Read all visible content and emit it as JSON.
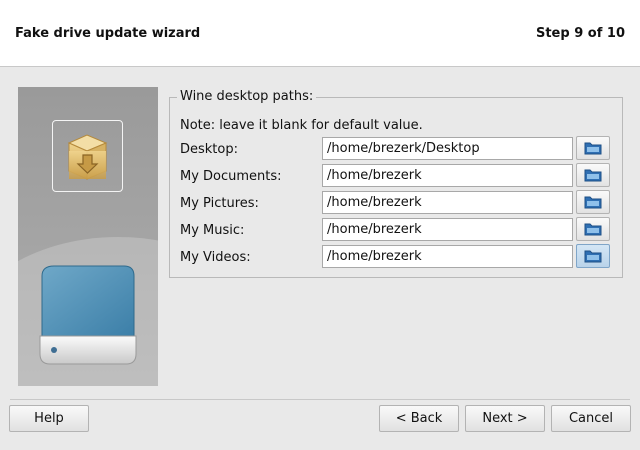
{
  "header": {
    "title": "Fake drive update wizard",
    "step": "Step 9 of 10"
  },
  "sidebar": {
    "top_icon": "package-install-icon",
    "bottom_icon": "hard-drive-icon"
  },
  "form": {
    "group_title": "Wine desktop paths:",
    "note": "Note: leave it blank for default value.",
    "fields": [
      {
        "label": "Desktop:",
        "value": "/home/brezerk/Desktop",
        "icon": "folder-icon"
      },
      {
        "label": "My Documents:",
        "value": "/home/brezerk",
        "icon": "folder-icon"
      },
      {
        "label": "My Pictures:",
        "value": "/home/brezerk",
        "icon": "folder-icon"
      },
      {
        "label": "My Music:",
        "value": "/home/brezerk",
        "icon": "folder-icon"
      },
      {
        "label": "My Videos:",
        "value": "/home/brezerk",
        "icon": "folder-icon"
      }
    ]
  },
  "buttons": {
    "help": "Help",
    "back": "< Back",
    "next": "Next >",
    "cancel": "Cancel"
  },
  "colors": {
    "folder_blue": "#2f6fb3",
    "drive_teal": "#4f8fb2",
    "package_tan": "#d8b46a"
  }
}
